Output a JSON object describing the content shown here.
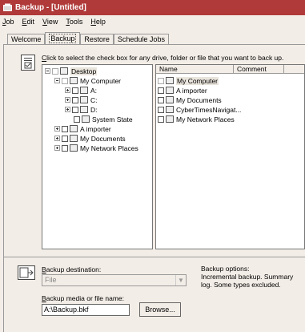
{
  "window": {
    "title": "Backup - [Untitled]"
  },
  "menu": [
    "Job",
    "Edit",
    "View",
    "Tools",
    "Help"
  ],
  "tabs": [
    "Welcome",
    "Backup",
    "Restore",
    "Schedule Jobs"
  ],
  "hint": "Click to select the check box for any drive, folder or file that you want to back up.",
  "tree": {
    "desktop": "Desktop",
    "my_computer": "My Computer",
    "a": "A:",
    "c": "C:",
    "d": "D:",
    "system_state": "System State",
    "a_importer": "A importer",
    "my_documents": "My Documents",
    "my_network_places": "My Network Places"
  },
  "list": {
    "headers": [
      "Name",
      "Comment"
    ],
    "rows": [
      "My Computer",
      "A importer",
      "My Documents",
      "CyberTimesNavigat...",
      "My Network Places"
    ]
  },
  "bottom": {
    "destination_label": "Backup destination:",
    "destination_value": "File",
    "media_label": "Backup media or file name:",
    "media_value": "A:\\Backup.bkf",
    "browse": "Browse...",
    "options_label": "Backup options:",
    "options_text": "Incremental backup.  Summary log.  Some types excluded."
  },
  "colors": {
    "titlebar": "#b03a3a",
    "window_bg": "#f3ede7"
  }
}
